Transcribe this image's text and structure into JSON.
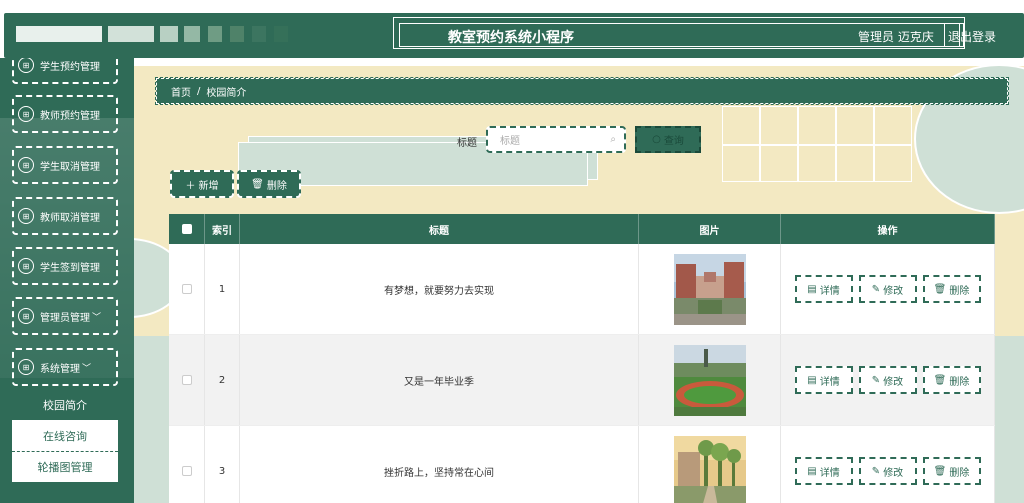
{
  "header": {
    "app_title": "教室预约系统小程序",
    "admin_text": "管理员 迈克庆",
    "logout_label": "退出登录"
  },
  "sidebar": {
    "items": [
      {
        "label": "学生预约管理"
      },
      {
        "label": "教师预约管理"
      },
      {
        "label": "学生取消管理"
      },
      {
        "label": "教师取消管理"
      },
      {
        "label": "学生签到管理"
      },
      {
        "label": "管理员管理",
        "chevron": "﹀"
      },
      {
        "label": "系统管理",
        "chevron": "﹀"
      }
    ],
    "submenu": [
      {
        "label": "校园简介"
      },
      {
        "label": "在线咨询"
      },
      {
        "label": "轮播图管理"
      }
    ]
  },
  "breadcrumb": {
    "home": "首页",
    "separator": "/",
    "current": "校园简介"
  },
  "search": {
    "label": "标题",
    "placeholder": "标题",
    "query_label": "查询",
    "query_icon": "search-icon"
  },
  "toolbar": {
    "add_label": "新增",
    "add_icon": "plus-icon",
    "delete_label": "删除",
    "delete_icon": "trash-icon"
  },
  "table": {
    "columns": [
      "索引",
      "标题",
      "图片",
      "操作"
    ],
    "rows": [
      {
        "index": "1",
        "title": "有梦想，就要努力去实现",
        "image": "campus-building-photo"
      },
      {
        "index": "2",
        "title": "又是一年毕业季",
        "image": "sports-field-photo"
      },
      {
        "index": "3",
        "title": "挫折路上，坚持常在心间",
        "image": "campus-road-photo"
      }
    ],
    "ops": {
      "detail": "详情",
      "edit": "修改",
      "delete": "删除"
    }
  },
  "colors": {
    "primary": "#2f6b57",
    "accent_bg": "#f3e9c2",
    "light_green": "#cfe0d6"
  }
}
